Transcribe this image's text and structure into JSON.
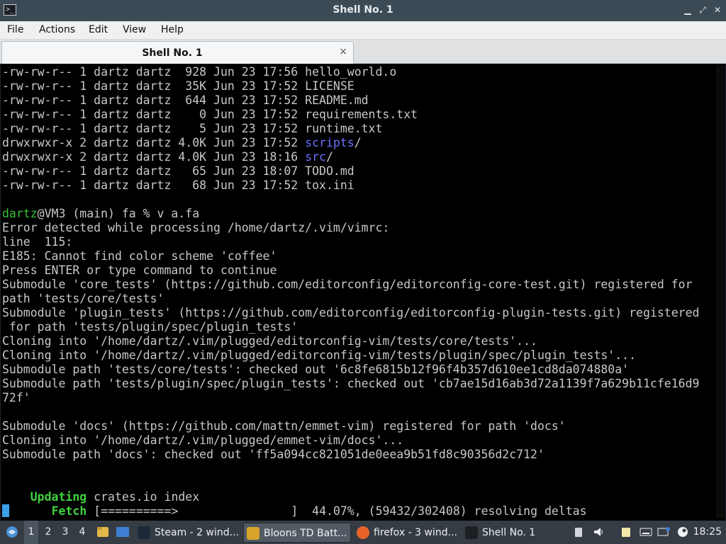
{
  "window": {
    "title": "Shell No. 1"
  },
  "menubar": {
    "items": [
      "File",
      "Actions",
      "Edit",
      "View",
      "Help"
    ]
  },
  "tabs": [
    {
      "label": "Shell No. 1",
      "close_glyph": "×"
    }
  ],
  "terminal": {
    "listing": [
      {
        "perms": "-rw-rw-r--",
        "links": "1",
        "owner": "dartz",
        "group": "dartz",
        "size": "928",
        "month": "Jun",
        "day": "23",
        "time": "17:56",
        "name": "hello_world.o",
        "is_dir": false
      },
      {
        "perms": "-rw-rw-r--",
        "links": "1",
        "owner": "dartz",
        "group": "dartz",
        "size": "35K",
        "month": "Jun",
        "day": "23",
        "time": "17:52",
        "name": "LICENSE",
        "is_dir": false
      },
      {
        "perms": "-rw-rw-r--",
        "links": "1",
        "owner": "dartz",
        "group": "dartz",
        "size": "644",
        "month": "Jun",
        "day": "23",
        "time": "17:52",
        "name": "README.md",
        "is_dir": false
      },
      {
        "perms": "-rw-rw-r--",
        "links": "1",
        "owner": "dartz",
        "group": "dartz",
        "size": "0",
        "month": "Jun",
        "day": "23",
        "time": "17:52",
        "name": "requirements.txt",
        "is_dir": false
      },
      {
        "perms": "-rw-rw-r--",
        "links": "1",
        "owner": "dartz",
        "group": "dartz",
        "size": "5",
        "month": "Jun",
        "day": "23",
        "time": "17:52",
        "name": "runtime.txt",
        "is_dir": false
      },
      {
        "perms": "drwxrwxr-x",
        "links": "2",
        "owner": "dartz",
        "group": "dartz",
        "size": "4.0K",
        "month": "Jun",
        "day": "23",
        "time": "17:52",
        "name": "scripts",
        "is_dir": true
      },
      {
        "perms": "drwxrwxr-x",
        "links": "2",
        "owner": "dartz",
        "group": "dartz",
        "size": "4.0K",
        "month": "Jun",
        "day": "23",
        "time": "18:16",
        "name": "src",
        "is_dir": true
      },
      {
        "perms": "-rw-rw-r--",
        "links": "1",
        "owner": "dartz",
        "group": "dartz",
        "size": "65",
        "month": "Jun",
        "day": "23",
        "time": "18:07",
        "name": "TODO.md",
        "is_dir": false
      },
      {
        "perms": "-rw-rw-r--",
        "links": "1",
        "owner": "dartz",
        "group": "dartz",
        "size": "68",
        "month": "Jun",
        "day": "23",
        "time": "17:52",
        "name": "tox.ini",
        "is_dir": false
      }
    ],
    "prompt": {
      "user": "dartz",
      "rest": "@VM3 (main) fa % v a.fa"
    },
    "output": [
      "Error detected while processing /home/dartz/.vim/vimrc:",
      "line  115:",
      "E185: Cannot find color scheme 'coffee'",
      "Press ENTER or type command to continue",
      "Submodule 'core_tests' (https://github.com/editorconfig/editorconfig-core-test.git) registered for",
      "path 'tests/core/tests'",
      "Submodule 'plugin_tests' (https://github.com/editorconfig/editorconfig-plugin-tests.git) registered",
      " for path 'tests/plugin/spec/plugin_tests'",
      "Cloning into '/home/dartz/.vim/plugged/editorconfig-vim/tests/core/tests'...",
      "Cloning into '/home/dartz/.vim/plugged/editorconfig-vim/tests/plugin/spec/plugin_tests'...",
      "Submodule path 'tests/core/tests': checked out '6c8fe6815b12f96f4b357d610ee1cd8da074880a'",
      "Submodule path 'tests/plugin/spec/plugin_tests': checked out 'cb7ae15d16ab3d72a1139f7a629b11cfe16d9",
      "72f'",
      "",
      "Submodule 'docs' (https://github.com/mattn/emmet-vim) registered for path 'docs'",
      "Cloning into '/home/dartz/.vim/plugged/emmet-vim/docs'...",
      "Submodule path 'docs': checked out 'ff5a094cc821051de0eea9b51fd8c90356d2c712'",
      "",
      ""
    ],
    "cargo_updating": {
      "keyword": "Updating",
      "text": "crates.io index"
    },
    "cargo_fetch": {
      "keyword": "Fetch",
      "bar": "[==========>                ]",
      "percent": "44.07%",
      "counts": "(59432/302408)",
      "status": "resolving deltas"
    }
  },
  "taskbar": {
    "desktops": [
      "1",
      "2",
      "3",
      "4"
    ],
    "active_desktop": "1",
    "tasks": [
      {
        "label": "Steam - 2 wind...",
        "icon": "steam-icon"
      },
      {
        "label": "Bloons TD Batt...",
        "icon": "game-icon"
      },
      {
        "label": "firefox - 3 wind...",
        "icon": "firefox-icon"
      },
      {
        "label": "Shell No. 1",
        "icon": "terminal-icon"
      }
    ],
    "clock": "18:25"
  }
}
